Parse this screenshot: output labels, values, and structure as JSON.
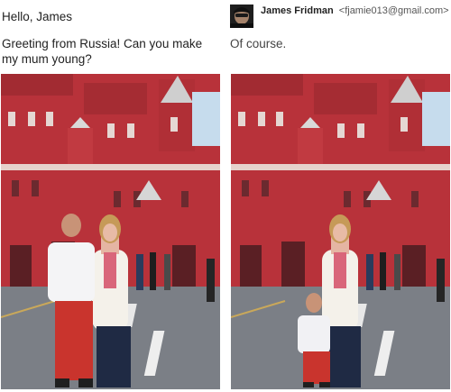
{
  "message": {
    "greeting": "Hello, James",
    "request": "Greeting from Russia! Can you make my mum young?"
  },
  "reply": {
    "sender_name": "James Fridman",
    "sender_email": "<fjamie013@gmail.com>",
    "body": "Of course."
  },
  "photos": {
    "original_alt": "Boy and his mother in front of the State Historical Museum",
    "edited_alt": "Edited photo with the boy shrunk to a toddler"
  },
  "colors": {
    "building_red": "#b8323a",
    "sky": "#a9c9e6",
    "pavement": "#7b7f86"
  }
}
